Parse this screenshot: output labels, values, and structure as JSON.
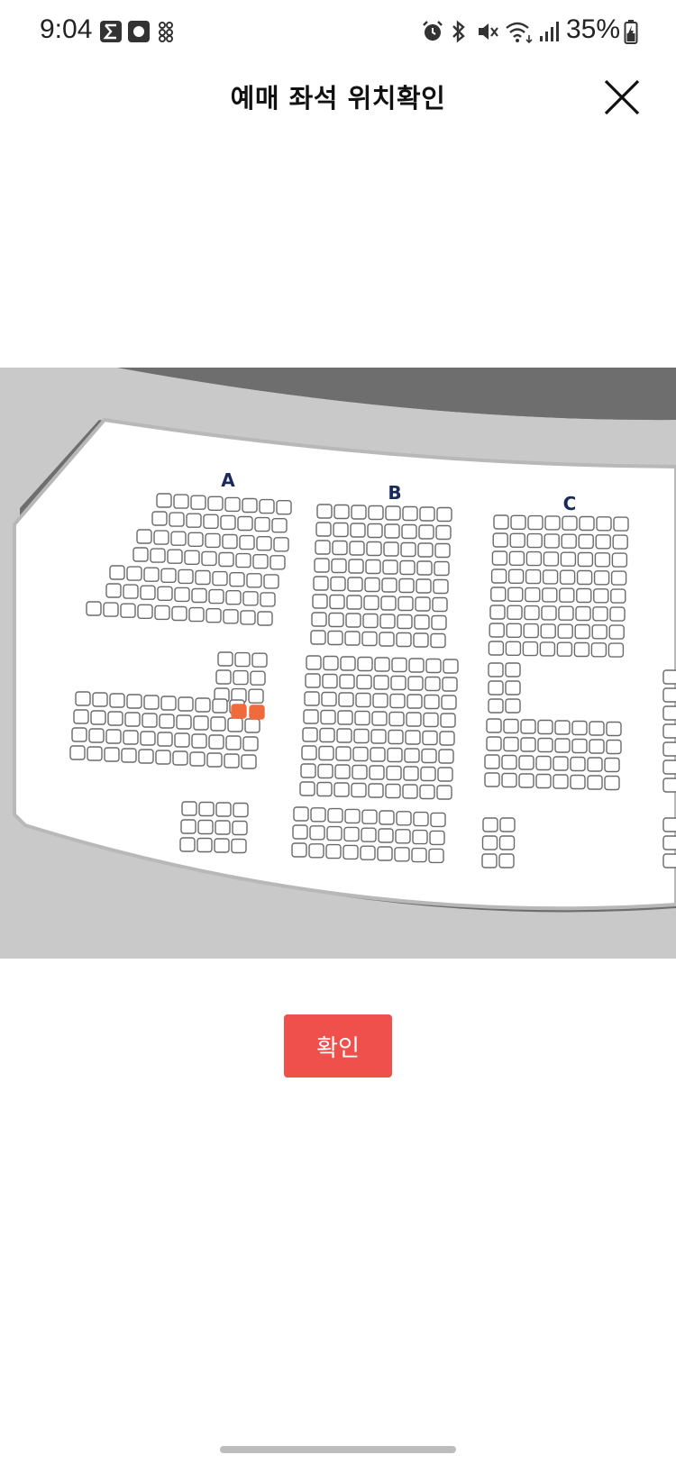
{
  "status_bar": {
    "time": "9:04",
    "left_icons": [
      "sigma-app-icon",
      "circle-app-icon",
      "grid-dots-icon"
    ],
    "right_icons": [
      "alarm-icon",
      "bluetooth-icon",
      "mute-icon",
      "wifi-icon",
      "signal-icon",
      "battery-icon"
    ],
    "battery": "35%"
  },
  "header": {
    "title": "예매 좌석 위치확인",
    "close_icon": "close-icon"
  },
  "seat_map": {
    "section_labels": [
      "A",
      "B",
      "C"
    ],
    "colors": {
      "background": "#6e6e6e",
      "stage_band": "#c9c9c9",
      "floor": "#ffffff",
      "seat_outline": "#6a6a6a",
      "selected_seat": "#f06a3c",
      "section_label": "#1a2a5a"
    },
    "selected_seats": 2
  },
  "confirm_button": {
    "label": "확인",
    "color": "#f0504b"
  }
}
